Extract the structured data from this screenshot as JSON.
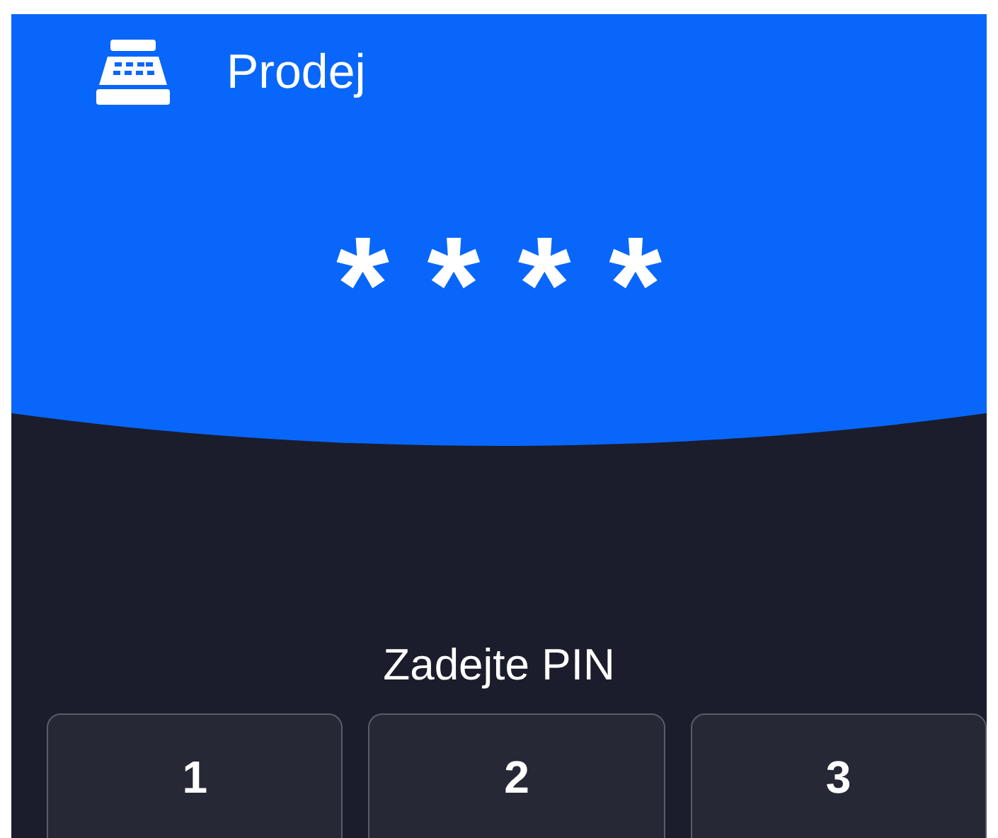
{
  "header": {
    "title": "Prodej",
    "pin_display": "****"
  },
  "prompt": "Zadejte PIN",
  "keypad": [
    "1",
    "2",
    "3"
  ]
}
